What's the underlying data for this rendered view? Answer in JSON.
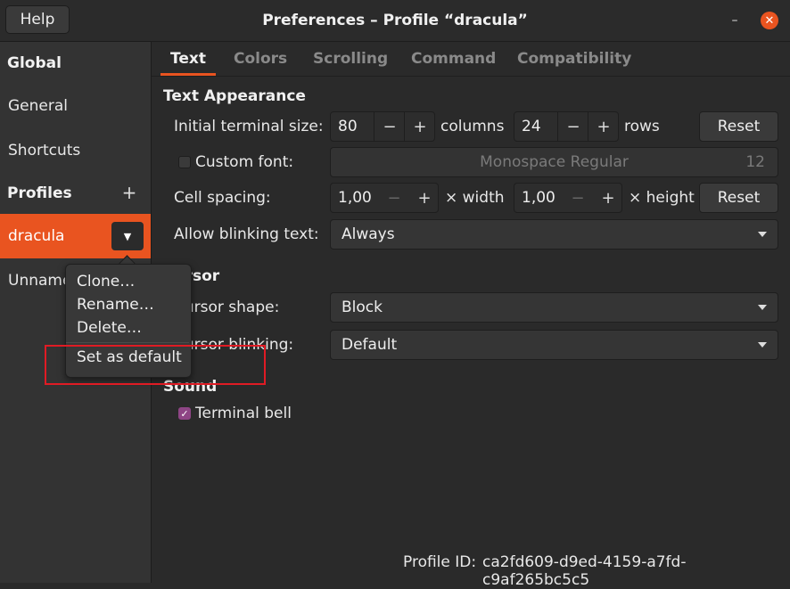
{
  "header": {
    "help_label": "Help",
    "title": "Preferences – Profile “dracula”",
    "minimize_glyph": "–",
    "close_glyph": "✕"
  },
  "sidebar": {
    "global_heading": "Global",
    "items": [
      {
        "label": "General"
      },
      {
        "label": "Shortcuts"
      }
    ],
    "profiles_heading": "Profiles",
    "add_glyph": "+",
    "profiles": [
      {
        "label": "dracula",
        "selected": true
      },
      {
        "label": "Unnamed"
      }
    ]
  },
  "profile_menu": {
    "items": [
      {
        "label": "Clone…"
      },
      {
        "label": "Rename…"
      },
      {
        "label": "Delete…"
      },
      {
        "label": "Set as default"
      }
    ]
  },
  "tabs": [
    {
      "label": "Text",
      "active": true
    },
    {
      "label": "Colors"
    },
    {
      "label": "Scrolling"
    },
    {
      "label": "Command"
    },
    {
      "label": "Compatibility"
    }
  ],
  "text_appearance": {
    "heading": "Text Appearance",
    "initial_size_label": "Initial terminal size:",
    "columns_value": "80",
    "columns_label": "columns",
    "rows_value": "24",
    "rows_label": "rows",
    "reset_label": "Reset",
    "custom_font_label": "Custom font:",
    "custom_font_checked": false,
    "font_name": "Monospace Regular",
    "font_size": "12",
    "cell_spacing_label": "Cell spacing:",
    "width_value": "1,00",
    "width_label": "× width",
    "height_value": "1,00",
    "height_label": "× height",
    "blink_label": "Allow blinking text:",
    "blink_value": "Always"
  },
  "cursor": {
    "heading": "Cursor",
    "shape_label": "Cursor shape:",
    "shape_value": "Block",
    "blinking_label": "Cursor blinking:",
    "blinking_value": "Default"
  },
  "sound": {
    "heading": "Sound",
    "bell_label": "Terminal bell",
    "bell_checked": true
  },
  "profile_id": {
    "label": "Profile ID:",
    "value": "ca2fd609-d9ed-4159-a7fd-c9af265bc5c5"
  },
  "colors": {
    "accent": "#e95420",
    "checkbox_checked": "#8e4585",
    "highlight_box": "#e01b24"
  }
}
